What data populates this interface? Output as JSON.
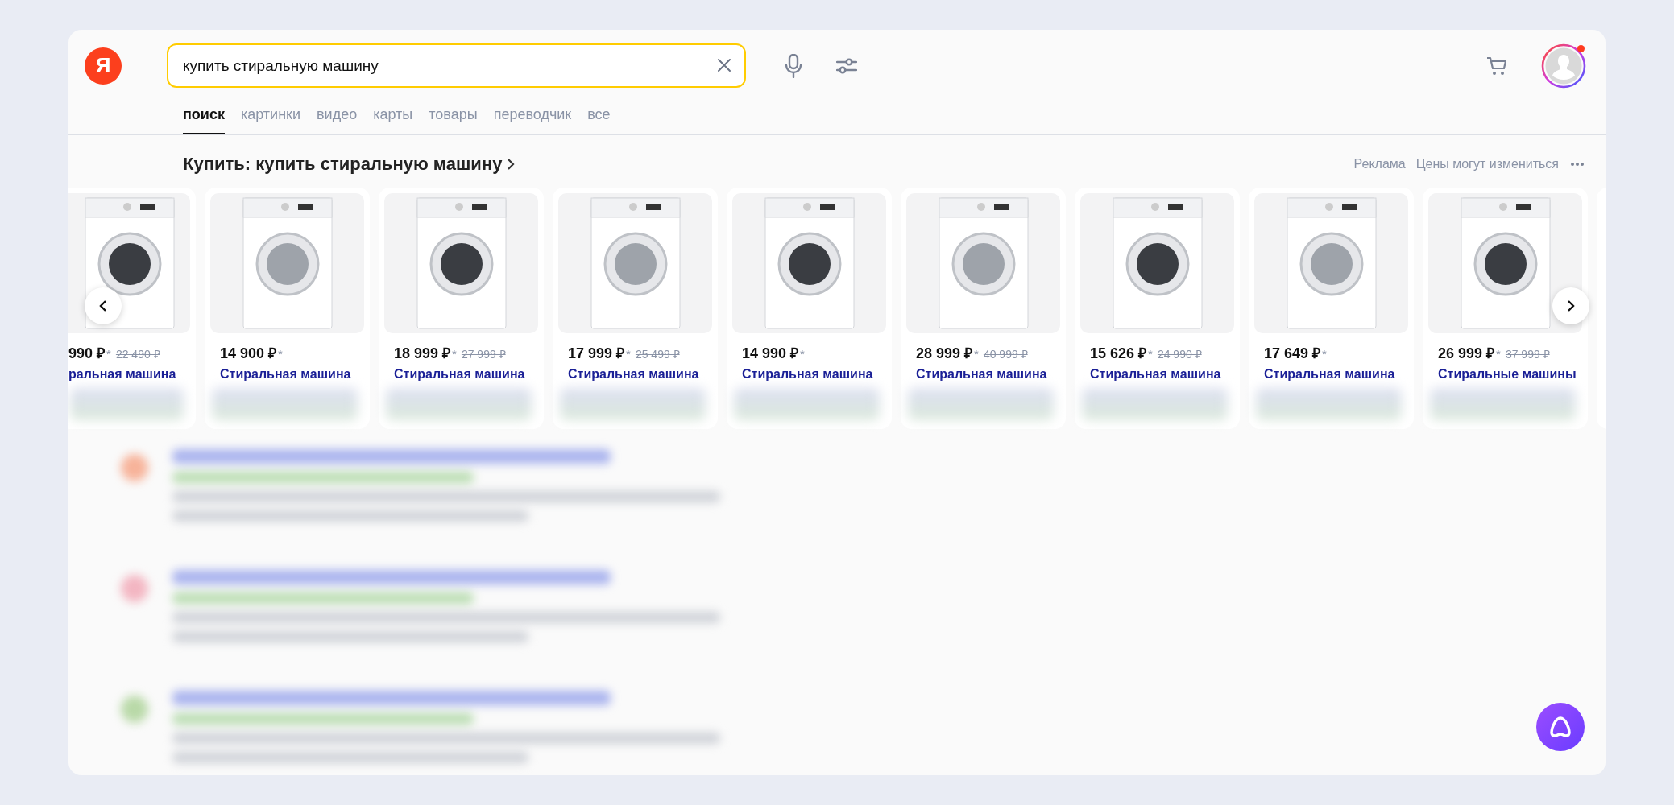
{
  "logo": {
    "letter": "Я"
  },
  "search": {
    "value": "купить стиральную машину"
  },
  "account": {
    "has_notification": true
  },
  "tabs": [
    {
      "label": "поиск",
      "selected": true
    },
    {
      "label": "картинки",
      "selected": false
    },
    {
      "label": "видео",
      "selected": false
    },
    {
      "label": "карты",
      "selected": false
    },
    {
      "label": "товары",
      "selected": false
    },
    {
      "label": "переводчик",
      "selected": false
    },
    {
      "label": "все",
      "selected": false
    }
  ],
  "shopping": {
    "heading": "Купить: купить стиральную машину",
    "ad_label": "Реклама",
    "note": "Цены могут измениться",
    "products": [
      {
        "price": "990 ₽",
        "price_mark": "*",
        "old_price": "22 490 ₽",
        "title": "ральная машина",
        "partial": true
      },
      {
        "price": "14 900 ₽",
        "price_mark": "*",
        "title": "Стиральная машина",
        "partial": false
      },
      {
        "price": "18 999 ₽",
        "price_mark": "*",
        "old_price": "27 999 ₽",
        "title": "Стиральная машина",
        "partial": false
      },
      {
        "price": "17 999 ₽",
        "price_mark": "*",
        "old_price": "25 499 ₽",
        "title": "Стиральная машина",
        "partial": false
      },
      {
        "price": "14 990 ₽",
        "price_mark": "*",
        "title": "Стиральная машина",
        "partial": false
      },
      {
        "price": "28 999 ₽",
        "price_mark": "*",
        "old_price": "40 999 ₽",
        "title": "Стиральная машина",
        "partial": false
      },
      {
        "price": "15 626 ₽",
        "price_mark": "*",
        "old_price": "24 990 ₽",
        "title": "Стиральная машина",
        "partial": false
      },
      {
        "price": "17 649 ₽",
        "price_mark": "*",
        "title": "Стиральная машина",
        "partial": false
      },
      {
        "price": "26 999 ₽",
        "price_mark": "*",
        "old_price": "37 999 ₽",
        "title": "Стиральные машины",
        "partial": false
      }
    ]
  }
}
